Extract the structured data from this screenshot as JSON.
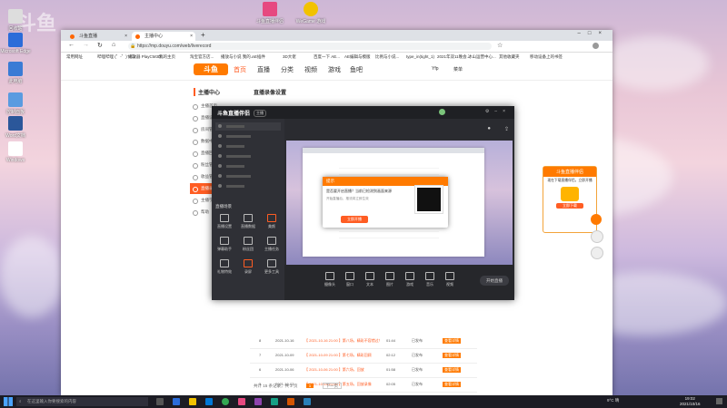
{
  "desktop": {
    "top_icons": [
      {
        "label": "斗鱼直播伴侣",
        "color": "#e64980"
      },
      {
        "label": "WeGame 游戏",
        "color": "#f2c200"
      }
    ],
    "left_icons": [
      {
        "label": "回收站"
      },
      {
        "label": "Microsoft Edge"
      },
      {
        "label": "此电脑"
      },
      {
        "label": "控制面板"
      },
      {
        "label": "Word文档"
      },
      {
        "label": "Windows"
      }
    ],
    "watermark": "斗鱼"
  },
  "browser": {
    "tabs": [
      {
        "label": "斗鱼直播",
        "active": false
      },
      {
        "label": "主播中心",
        "active": true
      }
    ],
    "new_tab": "+",
    "url": "https://mp.douyu.com/web/liverecord",
    "bookmarks": [
      "常用网址",
      "哔哩哔哩 (゜-゜)つロ",
      "播放器 PlayCM3D...",
      "我的主页",
      "淘宝官方店...",
      "播放与小说 我的...",
      "AE插件",
      "3D大佬",
      "百度一下 AE...",
      "AE编辑与模版",
      "比例与小说...",
      "type_in(tight_1)",
      "2021年双11晚会...",
      "冰山运营中心...",
      "其他收藏夹",
      "移动设备上的书签"
    ],
    "site": {
      "logo": "斗鱼",
      "nav": [
        "首页",
        "直播",
        "分类",
        "视频",
        "游戏",
        "鱼吧"
      ],
      "user_label": "Yfp",
      "menu_label": "菜单"
    },
    "sidebar": {
      "title": "主播中心",
      "items": [
        "主播首页",
        "直播设置",
        "房间管理",
        "数据中心",
        "直播回放",
        "粉丝管理",
        "收益管理",
        "直播录像",
        "主播学院",
        "帮助"
      ]
    },
    "content": {
      "title": "直播录像设置",
      "rows": [
        {
          "id": "8",
          "date": "2021-10-16",
          "title": "【 2021-10-16 21:00 】第八场，精彩不容错过！",
          "dur": "01:44",
          "status": "已发布",
          "action": "查看详情"
        },
        {
          "id": "7",
          "date": "2021-10-09",
          "title": "【 2021-10-09 21:00 】第七场，精彩回顾",
          "dur": "02:12",
          "status": "已发布",
          "action": "查看详情"
        },
        {
          "id": "6",
          "date": "2021-10-06",
          "title": "【 2021-10-06 21:00 】第六场，回放",
          "dur": "01:58",
          "status": "已发布",
          "action": "查看详情"
        },
        {
          "id": "5",
          "date": "2021-10-03",
          "title": "【 2021-10-03 21:00 】第五场，回放录像",
          "dur": "02:05",
          "status": "已发布",
          "action": "查看详情"
        }
      ],
      "pagination": {
        "summary": "共计 15 条记录，共 2 页",
        "current": "1",
        "next": "下一页"
      }
    }
  },
  "obs": {
    "app_title": "斗鱼直播伴侣",
    "badge": "主播",
    "scene_title": "直播场景",
    "dialog": {
      "title": "提示",
      "message": "是否要开启直播？当前已检测到画面来源",
      "sub": "开始直播后，推流将立即生效",
      "confirm": "立即开播"
    },
    "tools": [
      "直播设置",
      "直播数据",
      "美颜",
      "弹幕助手",
      "粉丝团",
      "主播任务",
      "礼物特效",
      "录屏",
      "更多工具"
    ],
    "bottom_controls": [
      "摄像头",
      "窗口",
      "文本",
      "图片",
      "游戏",
      "音乐",
      "视频",
      "开始直播"
    ],
    "start_button": "开始直播"
  },
  "promo": {
    "title": "斗鱼直播伴侣",
    "text": "现在下载直播伴侣，立即开播",
    "button": "立即下载"
  },
  "taskbar": {
    "search_placeholder": "在这里输入你要搜索的内容",
    "weather": "9°C 晴",
    "time": "19:02",
    "date": "2021/10/16"
  }
}
